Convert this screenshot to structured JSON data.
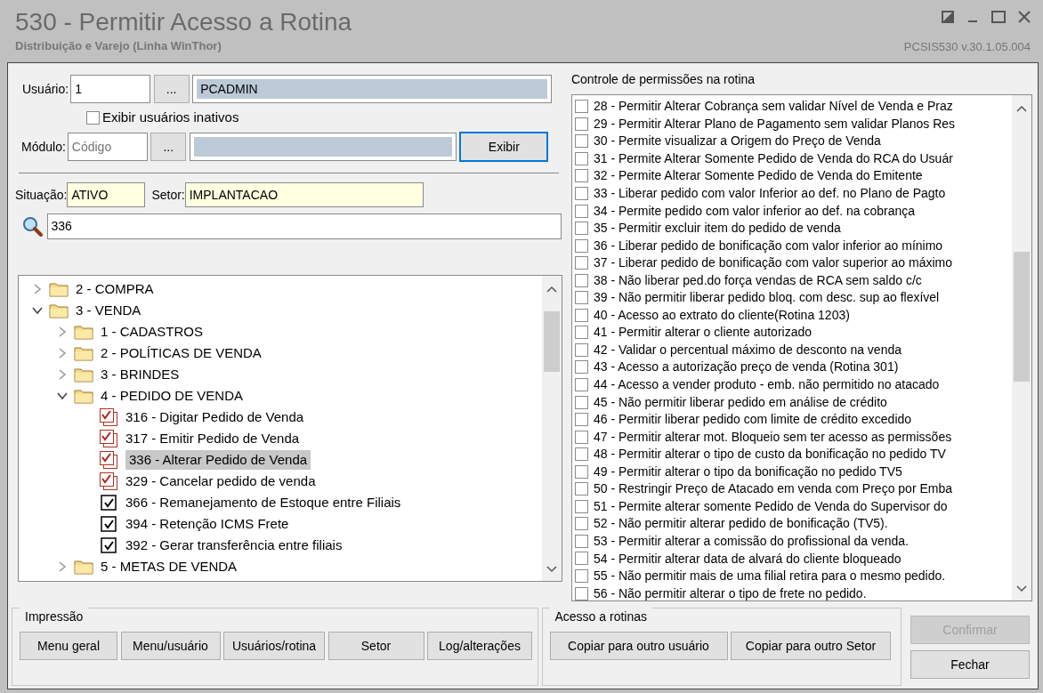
{
  "window": {
    "title": "530 - Permitir Acesso a Rotina",
    "subtitle": "Distribuição e Varejo (Linha WinThor)",
    "version": "PCSIS530  v.30.1.05.004"
  },
  "form": {
    "user_label": "Usuário:",
    "user_code": "1",
    "user_lookup": "...",
    "user_name": "PCADMIN",
    "show_inactive": {
      "label": "Exibir usuários inativos",
      "checked": false
    },
    "module_label": "Módulo:",
    "module_placeholder": "Código",
    "module_lookup": "...",
    "show_button": "Exibir",
    "situation_label": "Situação:",
    "situation": "ATIVO",
    "sector_label": "Setor:",
    "sector": "IMPLANTACAO",
    "search": "336"
  },
  "tree": [
    {
      "kind": "folder",
      "label": "2 - COMPRA",
      "expanded": false
    },
    {
      "kind": "folder",
      "label": "3 - VENDA",
      "expanded": true,
      "children": [
        {
          "kind": "folder",
          "label": "1 - CADASTROS",
          "expanded": false
        },
        {
          "kind": "folder",
          "label": "2 - POLÍTICAS DE VENDA",
          "expanded": false
        },
        {
          "kind": "folder",
          "label": "3 - BRINDES",
          "expanded": false
        },
        {
          "kind": "folder",
          "label": "4 - PEDIDO DE VENDA",
          "expanded": true,
          "children": [
            {
              "kind": "stacked",
              "label": "316 - Digitar Pedido de Venda",
              "checked": true,
              "selected": false
            },
            {
              "kind": "stacked",
              "label": "317 - Emitir Pedido de Venda",
              "checked": true,
              "selected": false
            },
            {
              "kind": "stacked",
              "label": "336 - Alterar Pedido de Venda",
              "checked": true,
              "selected": true
            },
            {
              "kind": "stacked",
              "label": "329 - Cancelar pedido de venda",
              "checked": true,
              "selected": false
            },
            {
              "kind": "plain",
              "label": "366 - Remanejamento de Estoque entre Filiais",
              "checked": true,
              "selected": false
            },
            {
              "kind": "plain",
              "label": "394 - Retenção ICMS Frete",
              "checked": true,
              "selected": false
            },
            {
              "kind": "plain",
              "label": "392 - Gerar transferência entre filiais",
              "checked": true,
              "selected": false
            }
          ]
        },
        {
          "kind": "folder",
          "label": "5 - METAS DE VENDA",
          "expanded": false
        }
      ]
    }
  ],
  "permissions": {
    "title": "Controle de permissões na rotina",
    "items": [
      {
        "label": "28 - Permitir Alterar Cobrança sem validar Nível de Venda e Praz",
        "checked": false
      },
      {
        "label": "29 - Permitir Alterar Plano de Pagamento sem validar Planos Res",
        "checked": false
      },
      {
        "label": "30 - Permite visualizar a Origem do Preço de Venda",
        "checked": false
      },
      {
        "label": "31 - Permite Alterar Somente Pedido de Venda do RCA do Usuár",
        "checked": false
      },
      {
        "label": "32 - Permite Alterar Somente Pedido de Venda do Emitente",
        "checked": false
      },
      {
        "label": "33 - Liberar pedido com valor Inferior ao def. no Plano de Pagto",
        "checked": false
      },
      {
        "label": "34 - Permite pedido com valor inferior ao def. na cobrança",
        "checked": false
      },
      {
        "label": "35 - Permitir excluir item do pedido de venda",
        "checked": false
      },
      {
        "label": "36 - Liberar pedido de bonificação com valor inferior ao mínimo",
        "checked": false
      },
      {
        "label": "37 - Liberar pedido de bonificação com valor superior ao máximo",
        "checked": false
      },
      {
        "label": "38 - Não liberar ped.do força vendas de RCA sem saldo c/c",
        "checked": false
      },
      {
        "label": "39 - Não permitir liberar pedido bloq. com desc. sup ao flexível",
        "checked": false
      },
      {
        "label": "40 - Acesso ao extrato do cliente(Rotina 1203)",
        "checked": false
      },
      {
        "label": "41 - Permitir alterar o cliente autorizado",
        "checked": false
      },
      {
        "label": "42 - Validar o percentual máximo de desconto na venda",
        "checked": false
      },
      {
        "label": "43 - Acesso a autorização preço de venda (Rotina 301)",
        "checked": false
      },
      {
        "label": "44 - Acesso a vender produto - emb. não permitido no atacado",
        "checked": false
      },
      {
        "label": "45 - Não permitir liberar pedido em análise de crédito",
        "checked": false
      },
      {
        "label": "46 - Permitir liberar pedido com limite de crédito excedido",
        "checked": false
      },
      {
        "label": "47 - Permitir alterar mot. Bloqueio sem ter acesso as permissões",
        "checked": false
      },
      {
        "label": "48 - Permitir alterar o tipo de custo da bonificação no pedido TV",
        "checked": false
      },
      {
        "label": "49 - Permitir alterar o tipo da bonificação no pedido TV5",
        "checked": false
      },
      {
        "label": "50 - Restringir Preço de Atacado em venda com Preço por Emba",
        "checked": false
      },
      {
        "label": "51 - Permite alterar somente Pedido de Venda do Supervisor do",
        "checked": false
      },
      {
        "label": "52 - Não permitir alterar pedido de bonificação (TV5).",
        "checked": false
      },
      {
        "label": "53 - Permitir alterar a comissão do profissional da venda.",
        "checked": false
      },
      {
        "label": "54 - Permitir alterar data de alvará do cliente bloqueado",
        "checked": false
      },
      {
        "label": "55 - Não permitir mais de uma filial retira para o mesmo pedido.",
        "checked": false
      },
      {
        "label": "56 - Não permitir alterar o tipo de frete no pedido.",
        "checked": false
      }
    ]
  },
  "printing": {
    "title": "Impressão",
    "buttons": [
      "Menu geral",
      "Menu/usuário",
      "Usuários/rotina",
      "Setor",
      "Log/alterações"
    ]
  },
  "access": {
    "title": "Acesso a rotinas",
    "buttons": [
      "Copiar para outro usuário",
      "Copiar para outro Setor"
    ]
  },
  "actions": [
    {
      "label": "Confirmar",
      "disabled": true
    },
    {
      "label": "Fechar",
      "disabled": false
    }
  ]
}
